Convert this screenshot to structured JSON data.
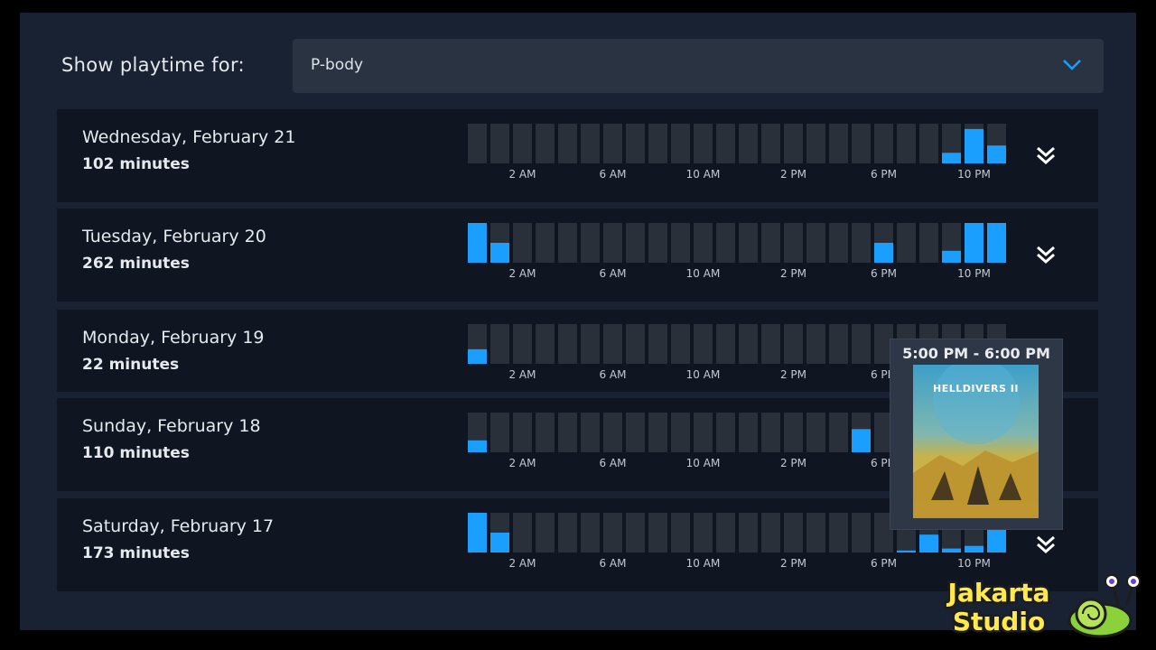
{
  "filter": {
    "label": "Show playtime for:",
    "selected": "P-body"
  },
  "hour_labels": [
    "2 AM",
    "6 AM",
    "10 AM",
    "2 PM",
    "6 PM",
    "10 PM"
  ],
  "colors": {
    "bar_active": "#1a9fff",
    "bar_empty": "#2a3039",
    "row_bg": "#0f1621",
    "panel_bg": "#182233"
  },
  "chart_data": [
    {
      "type": "bar",
      "title": "",
      "categories": [
        "12 AM",
        "1 AM",
        "2 AM",
        "3 AM",
        "4 AM",
        "5 AM",
        "6 AM",
        "7 AM",
        "8 AM",
        "9 AM",
        "10 AM",
        "11 AM",
        "12 PM",
        "1 PM",
        "2 PM",
        "3 PM",
        "4 PM",
        "5 PM",
        "6 PM",
        "7 PM",
        "8 PM",
        "9 PM",
        "10 PM",
        "11 PM"
      ],
      "values": [
        0,
        0,
        0,
        0,
        0,
        0,
        0,
        0,
        0,
        0,
        0,
        0,
        0,
        0,
        0,
        0,
        0,
        0,
        0,
        0,
        0,
        16,
        52,
        27
      ],
      "ylim": [
        0,
        60
      ],
      "day": "Wednesday, February 21",
      "total": "102 minutes"
    },
    {
      "type": "bar",
      "categories": [
        "12 AM",
        "1 AM",
        "2 AM",
        "3 AM",
        "4 AM",
        "5 AM",
        "6 AM",
        "7 AM",
        "8 AM",
        "9 AM",
        "10 AM",
        "11 AM",
        "12 PM",
        "1 PM",
        "2 PM",
        "3 PM",
        "4 PM",
        "5 PM",
        "6 PM",
        "7 PM",
        "8 PM",
        "9 PM",
        "10 PM",
        "11 PM"
      ],
      "values": [
        60,
        30,
        0,
        0,
        0,
        0,
        0,
        0,
        0,
        0,
        0,
        0,
        0,
        0,
        0,
        0,
        0,
        0,
        30,
        0,
        0,
        18,
        60,
        60
      ],
      "ylim": [
        0,
        60
      ],
      "day": "Tuesday, February 20",
      "total": "262 minutes"
    },
    {
      "type": "bar",
      "categories": [
        "12 AM",
        "1 AM",
        "2 AM",
        "3 AM",
        "4 AM",
        "5 AM",
        "6 AM",
        "7 AM",
        "8 AM",
        "9 AM",
        "10 AM",
        "11 AM",
        "12 PM",
        "1 PM",
        "2 PM",
        "3 PM",
        "4 PM",
        "5 PM",
        "6 PM",
        "7 PM",
        "8 PM",
        "9 PM",
        "10 PM",
        "11 PM"
      ],
      "values": [
        22,
        0,
        0,
        0,
        0,
        0,
        0,
        0,
        0,
        0,
        0,
        0,
        0,
        0,
        0,
        0,
        0,
        0,
        0,
        0,
        0,
        0,
        0,
        0
      ],
      "ylim": [
        0,
        60
      ],
      "day": "Monday, February 19",
      "total": "22 minutes"
    },
    {
      "type": "bar",
      "categories": [
        "12 AM",
        "1 AM",
        "2 AM",
        "3 AM",
        "4 AM",
        "5 AM",
        "6 AM",
        "7 AM",
        "8 AM",
        "9 AM",
        "10 AM",
        "11 AM",
        "12 PM",
        "1 PM",
        "2 PM",
        "3 PM",
        "4 PM",
        "5 PM",
        "6 PM",
        "7 PM",
        "8 PM",
        "9 PM",
        "10 PM",
        "11 PM"
      ],
      "values": [
        18,
        0,
        0,
        0,
        0,
        0,
        0,
        0,
        0,
        0,
        0,
        0,
        0,
        0,
        0,
        0,
        0,
        35,
        0,
        0,
        0,
        0,
        0,
        0
      ],
      "ylim": [
        0,
        60
      ],
      "day": "Sunday, February 18",
      "total": "110 minutes"
    },
    {
      "type": "bar",
      "categories": [
        "12 AM",
        "1 AM",
        "2 AM",
        "3 AM",
        "4 AM",
        "5 AM",
        "6 AM",
        "7 AM",
        "8 AM",
        "9 AM",
        "10 AM",
        "11 AM",
        "12 PM",
        "1 PM",
        "2 PM",
        "3 PM",
        "4 PM",
        "5 PM",
        "6 PM",
        "7 PM",
        "8 PM",
        "9 PM",
        "10 PM",
        "11 PM"
      ],
      "values": [
        60,
        30,
        0,
        0,
        0,
        0,
        0,
        0,
        0,
        0,
        0,
        0,
        0,
        0,
        0,
        0,
        0,
        0,
        0,
        3,
        27,
        6,
        10,
        35
      ],
      "ylim": [
        0,
        60
      ],
      "day": "Saturday, February 17",
      "total": "173 minutes"
    }
  ],
  "tooltip": {
    "time_range": "5:00 PM - 6:00 PM",
    "game_cover_text": "HELLDIVERS II"
  },
  "watermark": {
    "line1": "Jakarta",
    "line2": "Studio"
  }
}
